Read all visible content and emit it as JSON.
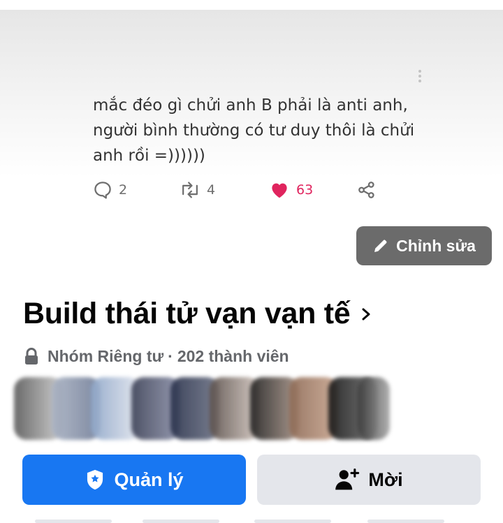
{
  "tweet": {
    "lines": [
      "mắc đéo gì chửi anh B phải là anti anh,",
      "người bình thường có tư duy thôi là chửi",
      "anh rồi =))))))"
    ],
    "replies": "2",
    "retweets": "4",
    "likes": "63"
  },
  "edit_button": {
    "label": "Chỉnh sửa"
  },
  "group": {
    "title": "Build thái tử vạn vạn tế",
    "privacy": "Nhóm Riêng tư",
    "separator": "·",
    "members": "202 thành viên"
  },
  "actions": {
    "manage_label": "Quản lý",
    "invite_label": "Mời"
  },
  "colors": {
    "primary": "#1877f2",
    "like": "#e0245e",
    "edit_bg": "#6b6b6b",
    "secondary_bg": "#e4e6eb"
  }
}
